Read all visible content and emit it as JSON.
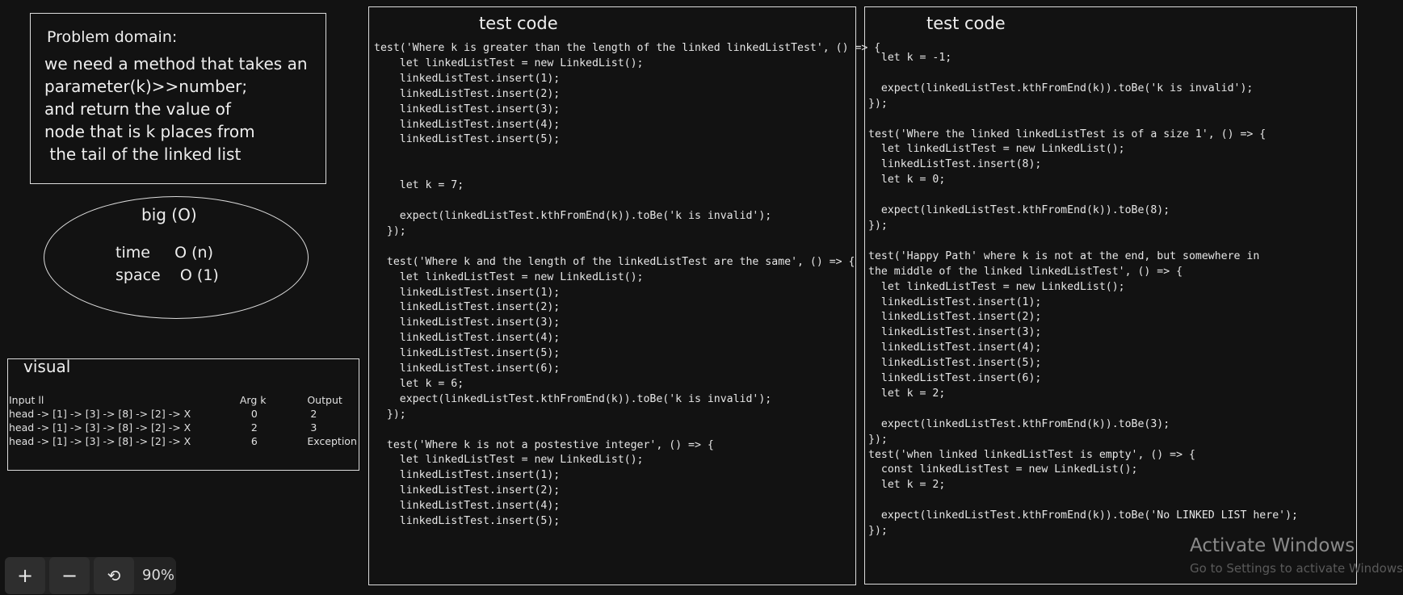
{
  "problem": {
    "title": "Problem domain:",
    "lines": [
      "we need a method that takes an",
      "parameter(k)>>number;",
      "and return the value of",
      "node that is k places from",
      " the tail of the linked list"
    ]
  },
  "bigo": {
    "title": "big (O)",
    "time_label": "time",
    "time_value": "O (n)",
    "space_label": "space",
    "space_value": "O (1)"
  },
  "visual": {
    "title": "visual",
    "headers": [
      "Input ll",
      "Arg k",
      "Output"
    ],
    "rows": [
      [
        "head -> [1] -> [3] -> [8] -> [2] -> X",
        "0",
        "2"
      ],
      [
        "head -> [1] -> [3] -> [8] -> [2] -> X",
        "2",
        "3"
      ],
      [
        "head -> [1] -> [3] -> [8] -> [2] -> X",
        "6",
        "Exception"
      ]
    ]
  },
  "panel1": {
    "title": "test code",
    "lines": [
      "test('Where k is greater than the length of the linked linkedListTest', () => {",
      "    let linkedListTest = new LinkedList();",
      "    linkedListTest.insert(1);",
      "    linkedListTest.insert(2);",
      "    linkedListTest.insert(3);",
      "    linkedListTest.insert(4);",
      "    linkedListTest.insert(5);",
      "",
      "",
      "    let k = 7;",
      "",
      "    expect(linkedListTest.kthFromEnd(k)).toBe('k is invalid');",
      "  });",
      "",
      "  test('Where k and the length of the linkedListTest are the same', () => {",
      "    let linkedListTest = new LinkedList();",
      "    linkedListTest.insert(1);",
      "    linkedListTest.insert(2);",
      "    linkedListTest.insert(3);",
      "    linkedListTest.insert(4);",
      "    linkedListTest.insert(5);",
      "    linkedListTest.insert(6);",
      "    let k = 6;",
      "    expect(linkedListTest.kthFromEnd(k)).toBe('k is invalid');",
      "  });",
      "",
      "  test('Where k is not a postestive integer', () => {",
      "    let linkedListTest = new LinkedList();",
      "    linkedListTest.insert(1);",
      "    linkedListTest.insert(2);",
      "    linkedListTest.insert(4);",
      "    linkedListTest.insert(5);"
    ]
  },
  "panel2": {
    "title": "test code",
    "lines": [
      "  let k = -1;",
      "",
      "  expect(linkedListTest.kthFromEnd(k)).toBe('k is invalid');",
      "});",
      "",
      "test('Where the linked linkedListTest is of a size 1', () => {",
      "  let linkedListTest = new LinkedList();",
      "  linkedListTest.insert(8);",
      "  let k = 0;",
      "",
      "  expect(linkedListTest.kthFromEnd(k)).toBe(8);",
      "});",
      "",
      "test('Happy Path' where k is not at the end, but somewhere in",
      "the middle of the linked linkedListTest', () => {",
      "  let linkedListTest = new LinkedList();",
      "  linkedListTest.insert(1);",
      "  linkedListTest.insert(2);",
      "  linkedListTest.insert(3);",
      "  linkedListTest.insert(4);",
      "  linkedListTest.insert(5);",
      "  linkedListTest.insert(6);",
      "  let k = 2;",
      "",
      "  expect(linkedListTest.kthFromEnd(k)).toBe(3);",
      "});",
      "test('when linked linkedListTest is empty', () => {",
      "  const linkedListTest = new LinkedList();",
      "  let k = 2;",
      "",
      "  expect(linkedListTest.kthFromEnd(k)).toBe('No LINKED LIST here');",
      "});"
    ]
  },
  "zoom": {
    "zoom_in": "+",
    "zoom_out": "−",
    "reset": "⟲",
    "value": "90%"
  },
  "watermark": {
    "title": "Activate Windows",
    "sub": "Go to Settings to activate Windows."
  }
}
